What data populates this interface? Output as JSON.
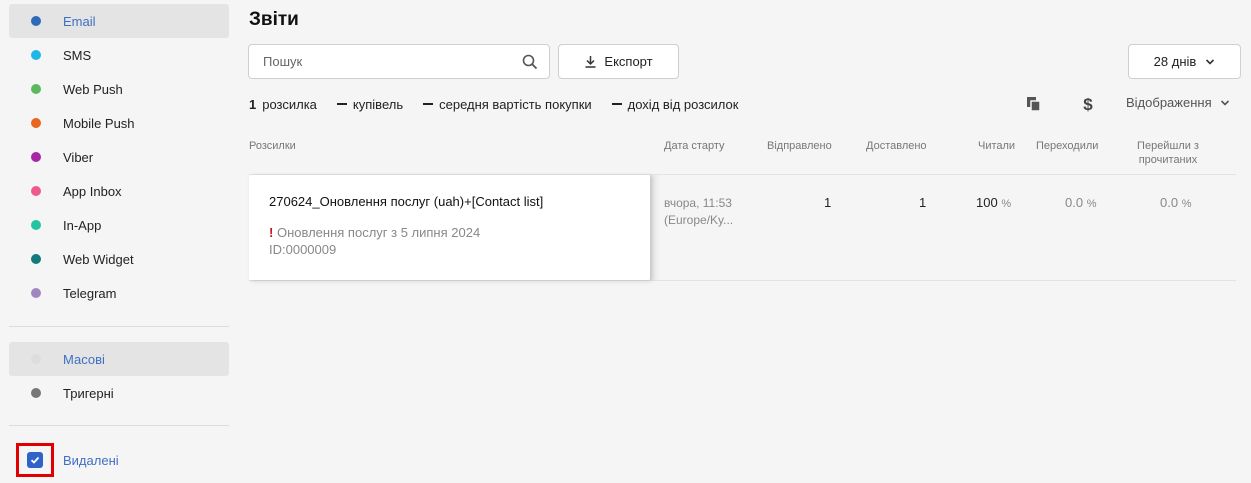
{
  "sidebar": {
    "channels": [
      {
        "label": "Email",
        "color": "#2d6bb6",
        "active": true
      },
      {
        "label": "SMS",
        "color": "#1fb8e6"
      },
      {
        "label": "Web Push",
        "color": "#5cb85c"
      },
      {
        "label": "Mobile Push",
        "color": "#e8661e"
      },
      {
        "label": "Viber",
        "color": "#a626a6"
      },
      {
        "label": "App Inbox",
        "color": "#f05a8a"
      },
      {
        "label": "In-App",
        "color": "#23c4a0"
      },
      {
        "label": "Web Widget",
        "color": "#117a7a"
      },
      {
        "label": "Telegram",
        "color": "#a187c0"
      }
    ],
    "types": [
      {
        "label": "Масові",
        "color": "#dddddd",
        "active": true
      },
      {
        "label": "Тригерні",
        "color": "#777777"
      }
    ],
    "deleted": {
      "label": "Видалені",
      "checked": true
    }
  },
  "header": {
    "title": "Звіти"
  },
  "toolbar": {
    "search_placeholder": "Пошук",
    "export_label": "Експорт",
    "period_label": "28 днів"
  },
  "metrics": {
    "mailings_count": "1",
    "mailings_label": "розсилка",
    "purchases_label": "купівель",
    "avg_purchase_label": "середня вартість покупки",
    "revenue_label": "дохід від розсилок"
  },
  "view": {
    "label": "Відображення",
    "currency_symbol": "$"
  },
  "table": {
    "headers": {
      "mailings": "Розсилки",
      "start_date": "Дата старту",
      "sent": "Відправлено",
      "delivered": "Доставлено",
      "read": "Читали",
      "clicked": "Переходили",
      "clicked_read_1": "Перейшли з",
      "clicked_read_2": "прочитаних"
    },
    "rows": [
      {
        "name": "270624_Оновлення послуг (uah)+[Contact list]",
        "exclamation": "!",
        "subject": "Оновлення послуг з 5 липня 2024",
        "id": "ID:0000009",
        "date_line1": "вчора, 11:53",
        "date_line2": "(Europe/Ky...",
        "sent": "1",
        "delivered": "1",
        "read": "100",
        "read_unit": "%",
        "clicked": "0.0",
        "clicked_unit": "%",
        "clicked_read": "0.0",
        "clicked_read_unit": "%"
      }
    ]
  }
}
